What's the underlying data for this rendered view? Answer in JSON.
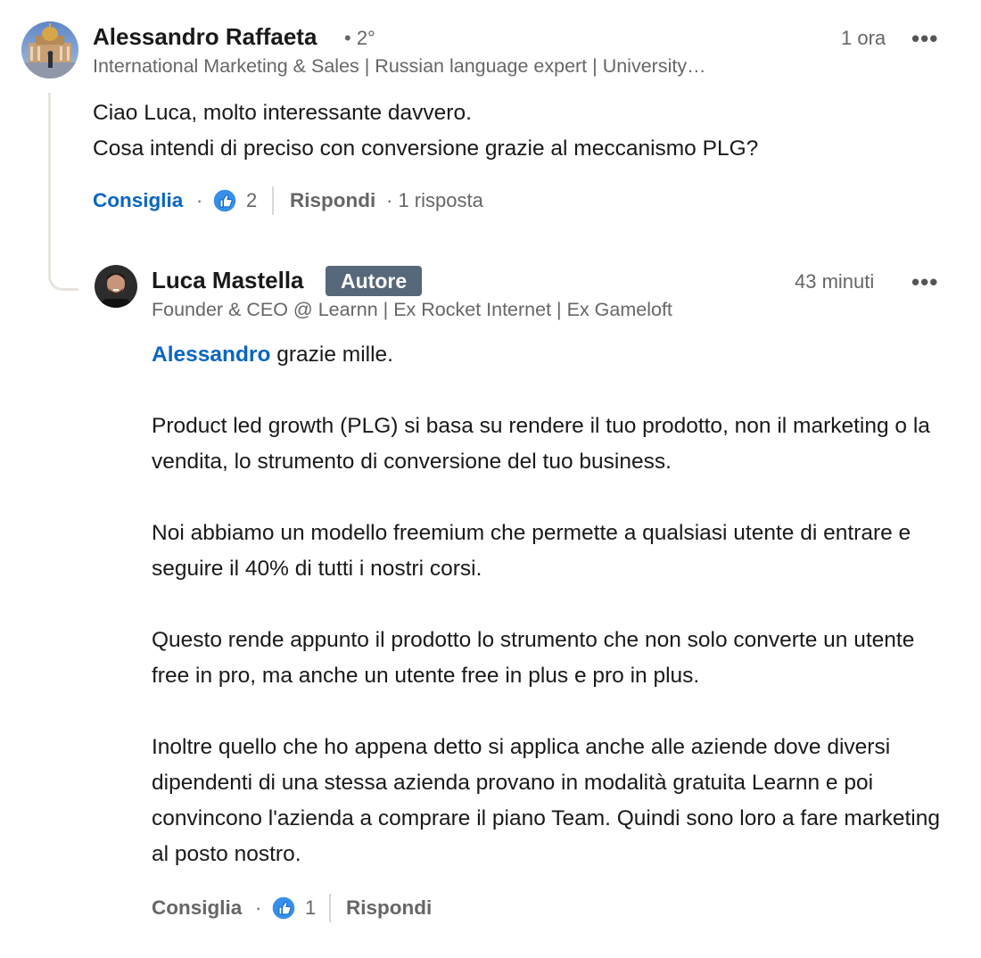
{
  "comment": {
    "author_name": "Alessandro Raffaeta",
    "degree": "• 2°",
    "headline": "International Marketing & Sales | Russian language expert | University…",
    "time": "1 ora",
    "more": "•••",
    "lines": [
      "Ciao Luca, molto interessante davvero.",
      "Cosa intendi di preciso con conversione grazie al meccanismo PLG?"
    ],
    "like_label": "Consiglia",
    "reaction_count": "2",
    "reply_label": "Rispondi",
    "replies_count": "· 1 risposta"
  },
  "reply": {
    "author_name": "Luca Mastella",
    "badge": "Autore",
    "headline": "Founder & CEO @ Learnn | Ex Rocket Internet | Ex Gameloft",
    "time": "43 minuti",
    "more": "•••",
    "mention": "Alessandro",
    "first_line_rest": " grazie mille.",
    "paragraphs": [
      "Product led growth (PLG) si basa su rendere il tuo prodotto, non il marketing o la vendita, lo strumento di conversione del tuo business.",
      "Noi abbiamo un modello freemium che permette a qualsiasi utente di entrare e seguire il 40% di tutti i nostri corsi.",
      "Questo rende appunto il prodotto lo strumento che non solo converte un utente free in pro, ma anche un utente free in plus e pro in plus.",
      "Inoltre quello che ho appena detto si applica anche alle aziende dove diversi dipendenti di una stessa azienda provano in modalità gratuita Learnn e poi convincono l'azienda a comprare il piano Team. Quindi sono loro a fare marketing al posto nostro."
    ],
    "like_label": "Consiglia",
    "reaction_count": "1",
    "reply_label": "Rispondi"
  },
  "colors": {
    "link_blue": "#0a66c2",
    "badge_bg": "#56687a",
    "thread_line": "#e8e3dc"
  },
  "icons": [
    "like-reaction-icon",
    "more-options-icon"
  ]
}
